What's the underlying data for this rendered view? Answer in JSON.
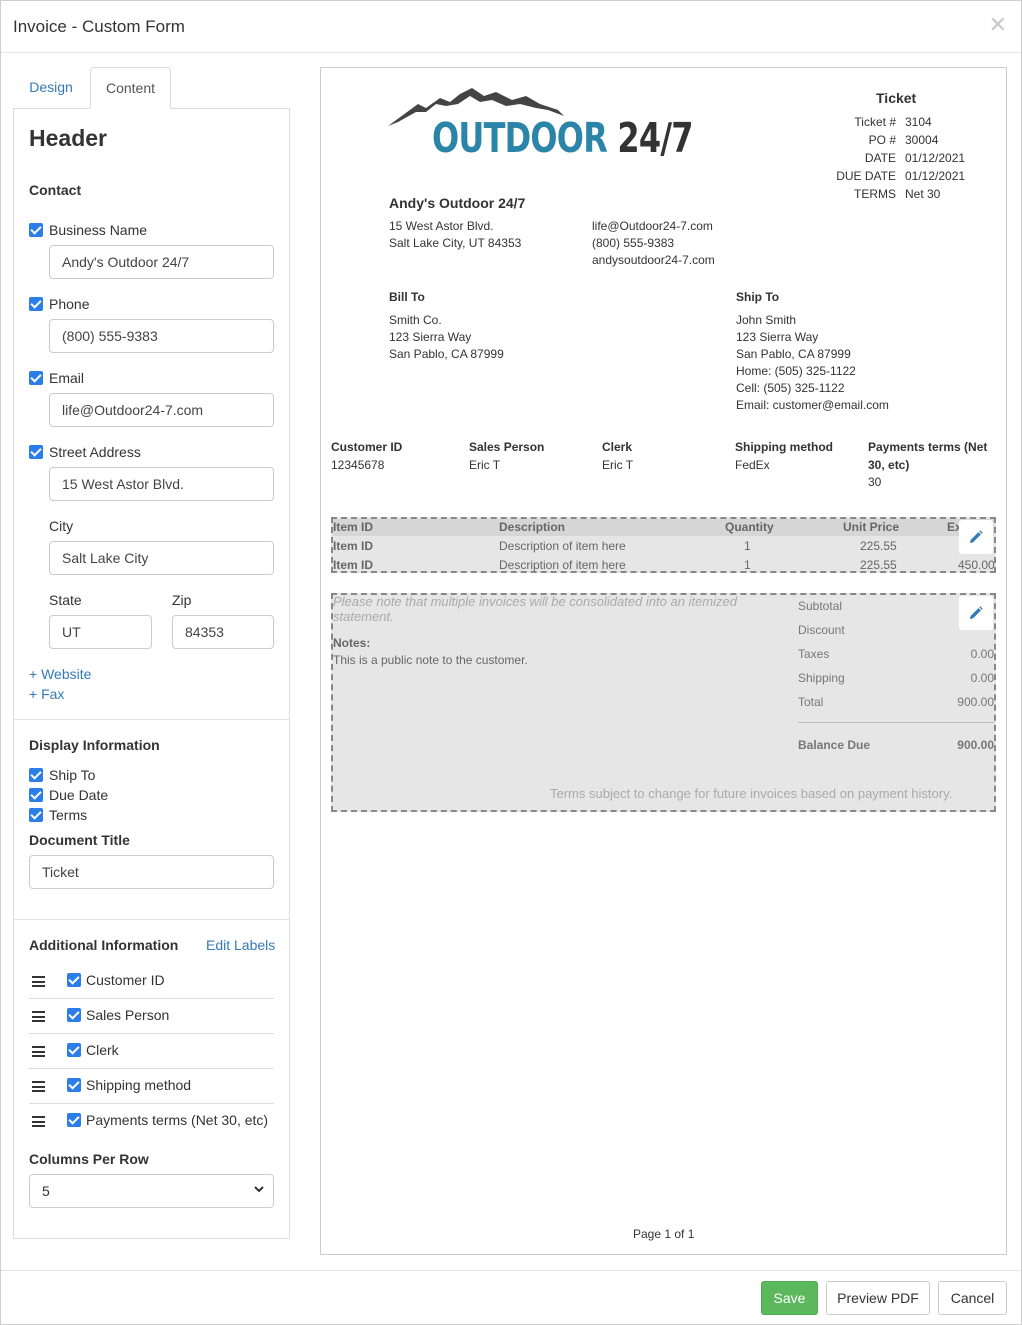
{
  "dialog": {
    "title": "Invoice - Custom Form",
    "close": "✕"
  },
  "tabs": {
    "design": "Design",
    "content": "Content"
  },
  "panel": {
    "header": "Header",
    "contact_title": "Contact",
    "business_name": {
      "label": "Business Name",
      "value": "Andy's Outdoor 24/7",
      "checked": true
    },
    "phone": {
      "label": "Phone",
      "value": "(800) 555-9383",
      "checked": true
    },
    "email": {
      "label": "Email",
      "value": "life@Outdoor24-7.com",
      "checked": true
    },
    "street": {
      "label": "Street Address",
      "value": "15 West Astor Blvd.",
      "checked": true
    },
    "city": {
      "label": "City",
      "value": "Salt Lake City"
    },
    "state": {
      "label": "State",
      "value": "UT"
    },
    "zip": {
      "label": "Zip",
      "value": "84353"
    },
    "add_website": "+ Website",
    "add_fax": "+ Fax",
    "display_title": "Display Information",
    "display_items": [
      "Ship To",
      "Due Date",
      "Terms"
    ],
    "doc_title_label": "Document Title",
    "doc_title_value": "Ticket",
    "additional_title": "Additional Information",
    "edit_labels": "Edit Labels",
    "additional_items": [
      "Customer ID",
      "Sales Person",
      "Clerk",
      "Shipping method",
      "Payments terms (Net 30, etc)"
    ],
    "columns_label": "Columns Per Row",
    "columns_value": "5"
  },
  "preview": {
    "logo": {
      "part1": "OUTDOOR",
      "part2": "24/7"
    },
    "doc_title": "Ticket",
    "meta": [
      {
        "label": "Ticket #",
        "value": "3104"
      },
      {
        "label": "PO #",
        "value": "30004"
      },
      {
        "label": "DATE",
        "value": "01/12/2021"
      },
      {
        "label": "DUE DATE",
        "value": "01/12/2021"
      },
      {
        "label": "TERMS",
        "value": "Net 30"
      }
    ],
    "business_name": "Andy's Outdoor 24/7",
    "address1": "15 West Astor Blvd.",
    "address2": "Salt Lake City, UT 84353",
    "email": "life@Outdoor24-7.com",
    "phone": "(800) 555-9383",
    "website": "andysoutdoor24-7.com",
    "bill_to": {
      "title": "Bill To",
      "lines": [
        "Smith Co.",
        "123 Sierra Way",
        "San Pablo, CA 87999"
      ]
    },
    "ship_to": {
      "title": "Ship To",
      "lines": [
        "John Smith",
        "123 Sierra Way",
        "San Pablo, CA 87999",
        "Home: (505) 325-1122",
        "Cell: (505) 325-1122",
        "Email: customer@email.com"
      ]
    },
    "info_cols": [
      {
        "label": "Customer ID",
        "value": "12345678"
      },
      {
        "label": "Sales Person",
        "value": "Eric T"
      },
      {
        "label": "Clerk",
        "value": "Eric T"
      },
      {
        "label": "Shipping method",
        "value": "FedEx"
      },
      {
        "label1": "Payments terms (Net",
        "label2": "30, etc)",
        "value": "30"
      }
    ],
    "items_header": {
      "id": "Item ID",
      "desc": "Description",
      "qty": "Quantity",
      "price": "Unit Price",
      "ext": "Ex"
    },
    "items": [
      {
        "id": "Item ID",
        "desc": "Description of item here",
        "qty": "1",
        "price": "225.55",
        "ext": ""
      },
      {
        "id": "Item ID",
        "desc": "Description of item here",
        "qty": "1",
        "price": "225.55",
        "ext": "450.00"
      }
    ],
    "note_line1": "Please note that multiple invoices will be consolidated into an itemized",
    "note_line2": "statement.",
    "notes_label": "Notes:",
    "notes_text": "This is a public note to the customer.",
    "totals": [
      {
        "label": "Subtotal",
        "value": ""
      },
      {
        "label": "Discount",
        "value": ""
      },
      {
        "label": "Taxes",
        "value": "0.00"
      },
      {
        "label": "Shipping",
        "value": "0.00"
      },
      {
        "label": "Total",
        "value": "900.00"
      }
    ],
    "balance_label": "Balance Due",
    "balance_value": "900.00",
    "terms_note": "Terms subject to change for future invoices based on payment history.",
    "page": "Page 1 of 1"
  },
  "footer": {
    "save": "Save",
    "preview": "Preview PDF",
    "cancel": "Cancel"
  },
  "colors": {
    "accent": "#2b7de9",
    "link": "#337ab7",
    "save": "#5cb85c",
    "logo_blue": "#2a85a8"
  }
}
